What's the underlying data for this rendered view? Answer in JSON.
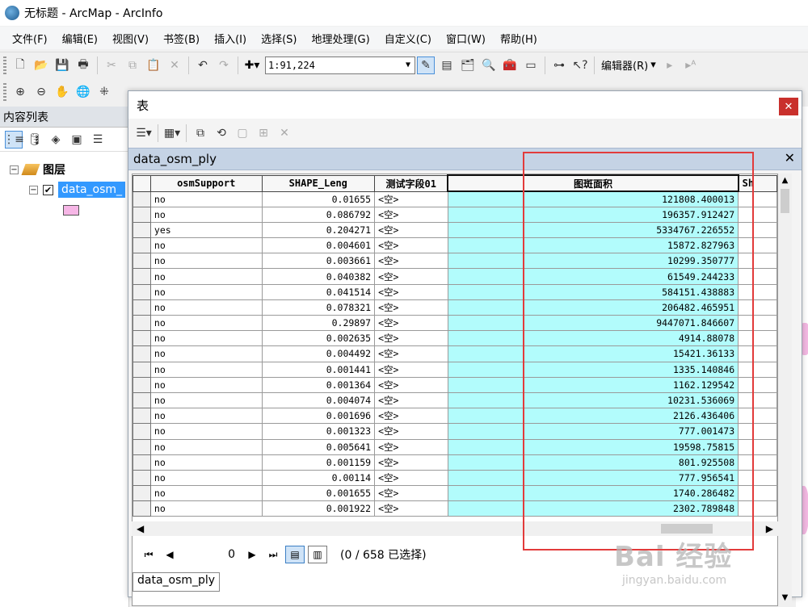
{
  "window": {
    "title": "无标题 - ArcMap - ArcInfo"
  },
  "menu": [
    "文件(F)",
    "编辑(E)",
    "视图(V)",
    "书签(B)",
    "插入(I)",
    "选择(S)",
    "地理处理(G)",
    "自定义(C)",
    "窗口(W)",
    "帮助(H)"
  ],
  "toolbar": {
    "scale": "1:91,224",
    "editor_label": "编辑器(R)",
    "editor_arrow": "▾"
  },
  "toc": {
    "header": "内容列表",
    "root_label": "图层",
    "layer_label": "data_osm_",
    "symbol_color": "#f6b6e6"
  },
  "table_window": {
    "title": "表",
    "close_glyph": "✕",
    "tab_label": "data_osm_ply",
    "tab_close": "✕",
    "columns": [
      "osmSupport",
      "SHAPE_Leng",
      "测试字段01",
      "图斑面积",
      "Sh"
    ],
    "rows": [
      [
        "no",
        "0.01655",
        "<空>",
        "121808.400013"
      ],
      [
        "no",
        "0.086792",
        "<空>",
        "196357.912427"
      ],
      [
        "yes",
        "0.204271",
        "<空>",
        "5334767.226552"
      ],
      [
        "no",
        "0.004601",
        "<空>",
        "15872.827963"
      ],
      [
        "no",
        "0.003661",
        "<空>",
        "10299.350777"
      ],
      [
        "no",
        "0.040382",
        "<空>",
        "61549.244233"
      ],
      [
        "no",
        "0.041514",
        "<空>",
        "584151.438883"
      ],
      [
        "no",
        "0.078321",
        "<空>",
        "206482.465951"
      ],
      [
        "no",
        "0.29897",
        "<空>",
        "9447071.846607"
      ],
      [
        "no",
        "0.002635",
        "<空>",
        "4914.88078"
      ],
      [
        "no",
        "0.004492",
        "<空>",
        "15421.36133"
      ],
      [
        "no",
        "0.001441",
        "<空>",
        "1335.140846"
      ],
      [
        "no",
        "0.001364",
        "<空>",
        "1162.129542"
      ],
      [
        "no",
        "0.004074",
        "<空>",
        "10231.536069"
      ],
      [
        "no",
        "0.001696",
        "<空>",
        "2126.436406"
      ],
      [
        "no",
        "0.001323",
        "<空>",
        "777.001473"
      ],
      [
        "no",
        "0.005641",
        "<空>",
        "19598.75815"
      ],
      [
        "no",
        "0.001159",
        "<空>",
        "801.925508"
      ],
      [
        "no",
        "0.00114",
        "<空>",
        "777.956541"
      ],
      [
        "no",
        "0.001655",
        "<空>",
        "1740.286482"
      ],
      [
        "no",
        "0.001922",
        "<空>",
        "2302.789848"
      ]
    ],
    "highlight_color": "#b2fcfc",
    "record_index": "0",
    "status": "(0 / 658 已选择)",
    "bottom_tab": "data_osm_ply"
  },
  "annotation": {
    "color": "#e23b3b"
  },
  "watermark": {
    "brand": "Bai 经验",
    "url": "jingyan.baidu.com"
  }
}
